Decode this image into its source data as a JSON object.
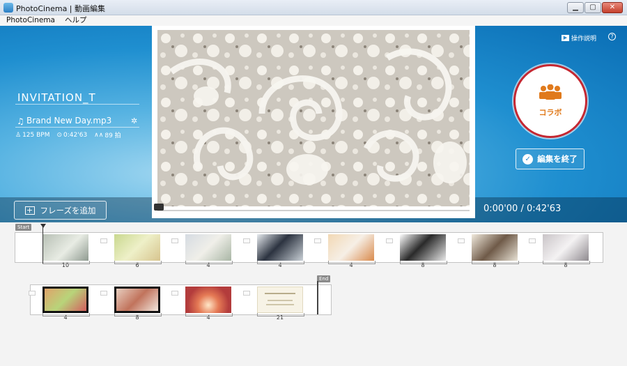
{
  "window": {
    "title": "PhotoCinema | 動画編集",
    "minimize": "▁",
    "maximize": "▢",
    "close": "✕"
  },
  "menu": [
    "PhotoCinema",
    "ヘルプ"
  ],
  "project": {
    "title": "INVITATION_T",
    "music": "Brand New Day.mp3",
    "bpm": "125 BPM",
    "length": "0:42'63",
    "beats": "89 拍"
  },
  "actions": {
    "add_phrase": "フレーズを追加",
    "collab": "コラボ",
    "finish": "編集を終了",
    "help": "操作説明",
    "help_q": "?"
  },
  "player": {
    "timecode": "0:00'00 / 0:42'63",
    "progress": 0
  },
  "timeline": {
    "start_label": "Start",
    "end_label": "End",
    "row1": [
      {
        "duration": "10"
      },
      {
        "duration": "6"
      },
      {
        "duration": "4"
      },
      {
        "duration": "4"
      },
      {
        "duration": "4"
      },
      {
        "duration": "8"
      },
      {
        "duration": "8"
      },
      {
        "duration": "8"
      }
    ],
    "row2": [
      {
        "duration": "4"
      },
      {
        "duration": "8"
      },
      {
        "duration": "4"
      },
      {
        "duration": "21"
      }
    ]
  }
}
